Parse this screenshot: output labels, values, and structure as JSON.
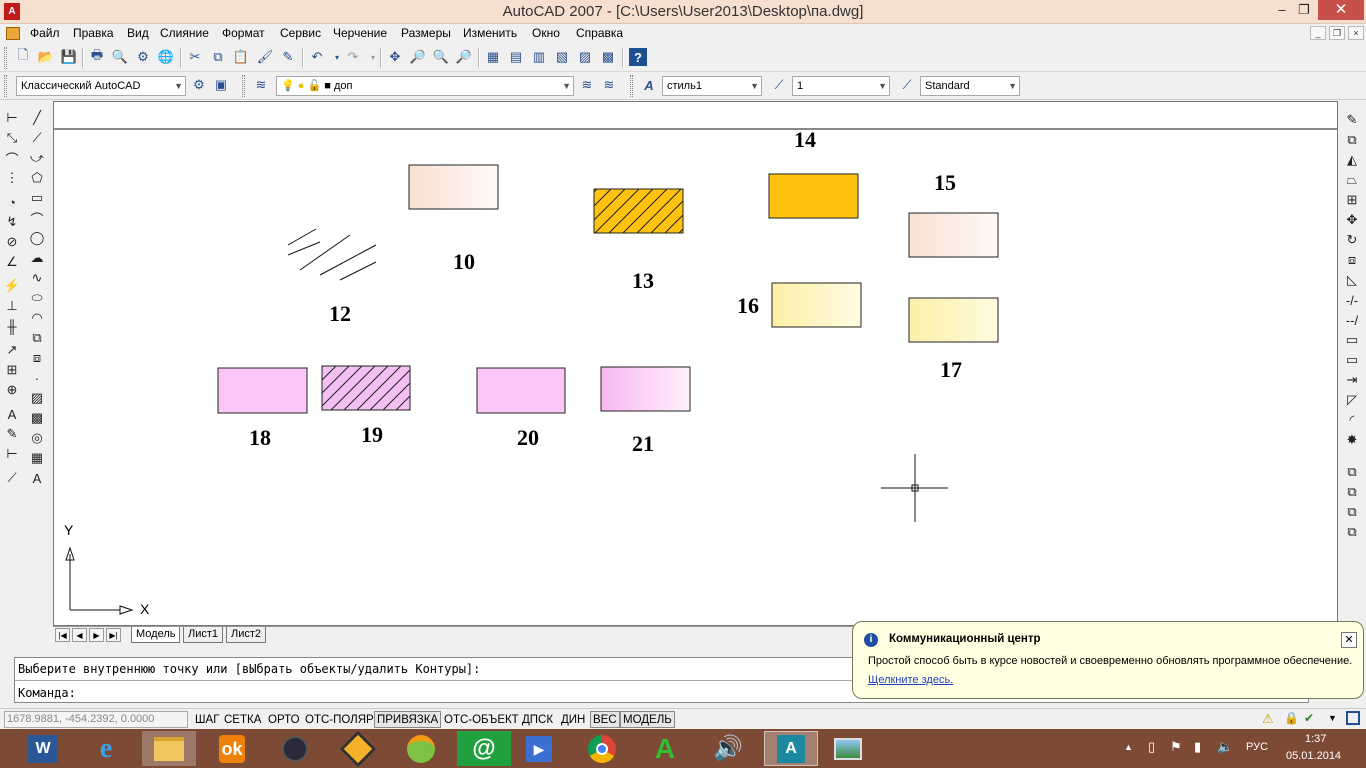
{
  "window": {
    "title": "AutoCAD 2007 - [C:\\Users\\User2013\\Desktop\\па.dwg]",
    "app_icon": "A",
    "min": "–",
    "max": "❐",
    "close": "✕"
  },
  "menu": [
    "Файл",
    "Правка",
    "Вид",
    "Слияние",
    "Формат",
    "Сервис",
    "Черчение",
    "Размеры",
    "Изменить",
    "Окно",
    "Справка"
  ],
  "mdi": {
    "min": "_",
    "restore": "❐",
    "close": "×"
  },
  "toolbar2": {
    "workspace": "Классический AutoCAD",
    "layer": "доп",
    "text_style": "стиль1",
    "dim_scale": "1",
    "dim_style": "Standard"
  },
  "drawing": {
    "labels": [
      "10",
      "12",
      "13",
      "14",
      "15",
      "16",
      "17",
      "18",
      "19",
      "20",
      "21"
    ],
    "ucs": {
      "x": "X",
      "y": "Y"
    }
  },
  "tabs": {
    "model": "Модель",
    "sheet1": "Лист1",
    "sheet2": "Лист2"
  },
  "command": {
    "line1": "Выберите внутреннюю точку или [вЫбрать объекты/удалить Контуры]:",
    "line2": "Команда:"
  },
  "status": {
    "coords": "1678.9881, -454.2392, 0.0000",
    "buttons": [
      "ШАГ",
      "СЕТКА",
      "ОРТО",
      "ОТС-ПОЛЯР",
      "ПРИВЯЗКА",
      "ОТС-ОБЪЕКТ",
      "ДПСК",
      "ДИН",
      "ВЕС",
      "МОДЕЛЬ"
    ]
  },
  "notification": {
    "title": "Коммуникационный центр",
    "body": "Простой способ быть в курсе новостей и своевременно обновлять программное обеспечение.",
    "link": "Щелкните здесь.",
    "close": "✕"
  },
  "taskbar": {
    "lang": "РУС",
    "time": "1:37",
    "date": "05.01.2014",
    "apps": [
      "word",
      "internet-explorer",
      "file-explorer",
      "odnoklassniki",
      "media-ball",
      "daemon-tools",
      "photo-app",
      "mail-agent",
      "video-player",
      "chrome",
      "green-a-app",
      "speaker-app",
      "autocad",
      "image-viewer"
    ]
  },
  "colors": {
    "titlebar": "#f6dfcf",
    "close": "#c7504b",
    "taskbar": "#7d4a35",
    "orange": "#ffc20e",
    "pink": "#fbc6f5",
    "cream": "#fdf5bd",
    "peach": "#fbe7dc"
  }
}
